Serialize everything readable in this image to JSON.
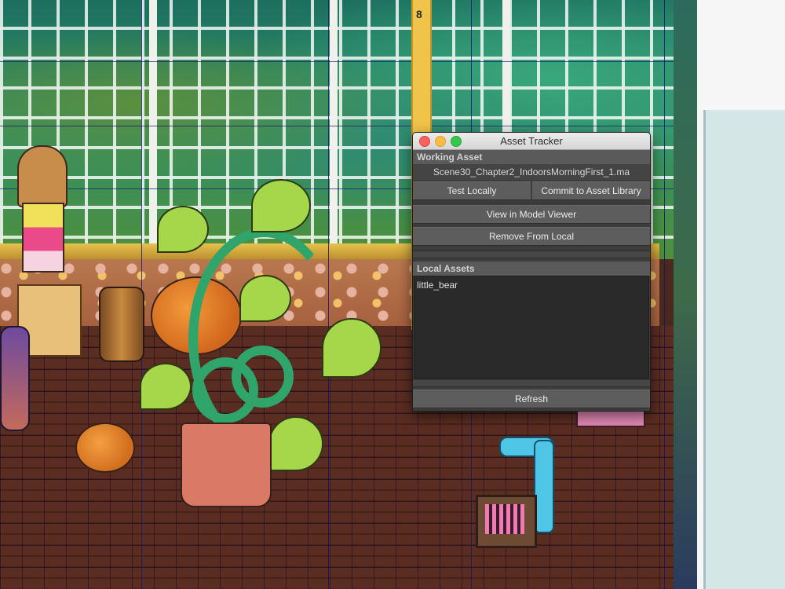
{
  "viewport": {
    "pole_label": "8"
  },
  "asset_tracker": {
    "title": "Asset Tracker",
    "working_asset_header": "Working Asset",
    "working_asset_name": "Scene30_Chapter2_IndoorsMorningFirst_1.ma",
    "test_locally_label": "Test Locally",
    "commit_label": "Commit to Asset Library",
    "view_in_model_viewer_label": "View in Model Viewer",
    "remove_from_local_label": "Remove From Local",
    "local_assets_header": "Local Assets",
    "local_assets": [
      "little_bear"
    ],
    "refresh_label": "Refresh"
  }
}
